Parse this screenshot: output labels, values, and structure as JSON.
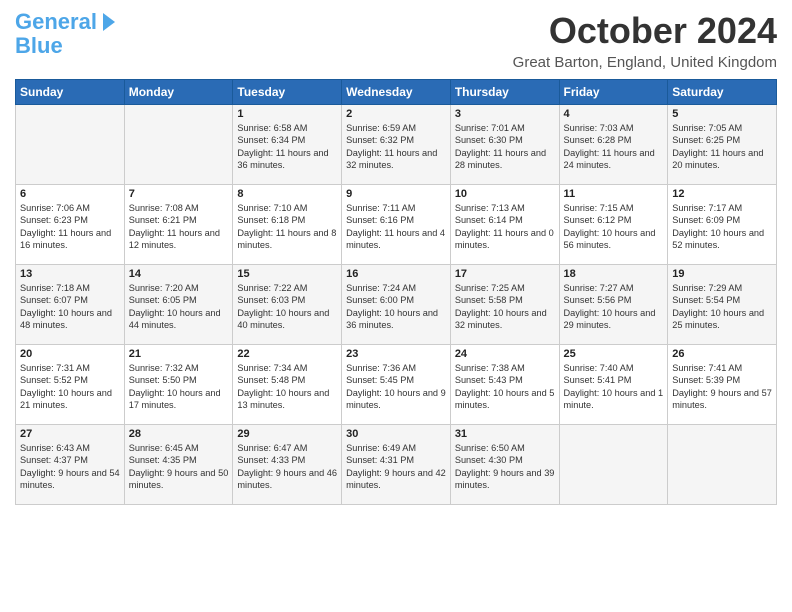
{
  "header": {
    "logo_line1": "General",
    "logo_line2": "Blue",
    "month_title": "October 2024",
    "location": "Great Barton, England, United Kingdom"
  },
  "days_of_week": [
    "Sunday",
    "Monday",
    "Tuesday",
    "Wednesday",
    "Thursday",
    "Friday",
    "Saturday"
  ],
  "weeks": [
    [
      {
        "day": "",
        "info": ""
      },
      {
        "day": "",
        "info": ""
      },
      {
        "day": "1",
        "info": "Sunrise: 6:58 AM\nSunset: 6:34 PM\nDaylight: 11 hours and 36 minutes."
      },
      {
        "day": "2",
        "info": "Sunrise: 6:59 AM\nSunset: 6:32 PM\nDaylight: 11 hours and 32 minutes."
      },
      {
        "day": "3",
        "info": "Sunrise: 7:01 AM\nSunset: 6:30 PM\nDaylight: 11 hours and 28 minutes."
      },
      {
        "day": "4",
        "info": "Sunrise: 7:03 AM\nSunset: 6:28 PM\nDaylight: 11 hours and 24 minutes."
      },
      {
        "day": "5",
        "info": "Sunrise: 7:05 AM\nSunset: 6:25 PM\nDaylight: 11 hours and 20 minutes."
      }
    ],
    [
      {
        "day": "6",
        "info": "Sunrise: 7:06 AM\nSunset: 6:23 PM\nDaylight: 11 hours and 16 minutes."
      },
      {
        "day": "7",
        "info": "Sunrise: 7:08 AM\nSunset: 6:21 PM\nDaylight: 11 hours and 12 minutes."
      },
      {
        "day": "8",
        "info": "Sunrise: 7:10 AM\nSunset: 6:18 PM\nDaylight: 11 hours and 8 minutes."
      },
      {
        "day": "9",
        "info": "Sunrise: 7:11 AM\nSunset: 6:16 PM\nDaylight: 11 hours and 4 minutes."
      },
      {
        "day": "10",
        "info": "Sunrise: 7:13 AM\nSunset: 6:14 PM\nDaylight: 11 hours and 0 minutes."
      },
      {
        "day": "11",
        "info": "Sunrise: 7:15 AM\nSunset: 6:12 PM\nDaylight: 10 hours and 56 minutes."
      },
      {
        "day": "12",
        "info": "Sunrise: 7:17 AM\nSunset: 6:09 PM\nDaylight: 10 hours and 52 minutes."
      }
    ],
    [
      {
        "day": "13",
        "info": "Sunrise: 7:18 AM\nSunset: 6:07 PM\nDaylight: 10 hours and 48 minutes."
      },
      {
        "day": "14",
        "info": "Sunrise: 7:20 AM\nSunset: 6:05 PM\nDaylight: 10 hours and 44 minutes."
      },
      {
        "day": "15",
        "info": "Sunrise: 7:22 AM\nSunset: 6:03 PM\nDaylight: 10 hours and 40 minutes."
      },
      {
        "day": "16",
        "info": "Sunrise: 7:24 AM\nSunset: 6:00 PM\nDaylight: 10 hours and 36 minutes."
      },
      {
        "day": "17",
        "info": "Sunrise: 7:25 AM\nSunset: 5:58 PM\nDaylight: 10 hours and 32 minutes."
      },
      {
        "day": "18",
        "info": "Sunrise: 7:27 AM\nSunset: 5:56 PM\nDaylight: 10 hours and 29 minutes."
      },
      {
        "day": "19",
        "info": "Sunrise: 7:29 AM\nSunset: 5:54 PM\nDaylight: 10 hours and 25 minutes."
      }
    ],
    [
      {
        "day": "20",
        "info": "Sunrise: 7:31 AM\nSunset: 5:52 PM\nDaylight: 10 hours and 21 minutes."
      },
      {
        "day": "21",
        "info": "Sunrise: 7:32 AM\nSunset: 5:50 PM\nDaylight: 10 hours and 17 minutes."
      },
      {
        "day": "22",
        "info": "Sunrise: 7:34 AM\nSunset: 5:48 PM\nDaylight: 10 hours and 13 minutes."
      },
      {
        "day": "23",
        "info": "Sunrise: 7:36 AM\nSunset: 5:45 PM\nDaylight: 10 hours and 9 minutes."
      },
      {
        "day": "24",
        "info": "Sunrise: 7:38 AM\nSunset: 5:43 PM\nDaylight: 10 hours and 5 minutes."
      },
      {
        "day": "25",
        "info": "Sunrise: 7:40 AM\nSunset: 5:41 PM\nDaylight: 10 hours and 1 minute."
      },
      {
        "day": "26",
        "info": "Sunrise: 7:41 AM\nSunset: 5:39 PM\nDaylight: 9 hours and 57 minutes."
      }
    ],
    [
      {
        "day": "27",
        "info": "Sunrise: 6:43 AM\nSunset: 4:37 PM\nDaylight: 9 hours and 54 minutes."
      },
      {
        "day": "28",
        "info": "Sunrise: 6:45 AM\nSunset: 4:35 PM\nDaylight: 9 hours and 50 minutes."
      },
      {
        "day": "29",
        "info": "Sunrise: 6:47 AM\nSunset: 4:33 PM\nDaylight: 9 hours and 46 minutes."
      },
      {
        "day": "30",
        "info": "Sunrise: 6:49 AM\nSunset: 4:31 PM\nDaylight: 9 hours and 42 minutes."
      },
      {
        "day": "31",
        "info": "Sunrise: 6:50 AM\nSunset: 4:30 PM\nDaylight: 9 hours and 39 minutes."
      },
      {
        "day": "",
        "info": ""
      },
      {
        "day": "",
        "info": ""
      }
    ]
  ]
}
